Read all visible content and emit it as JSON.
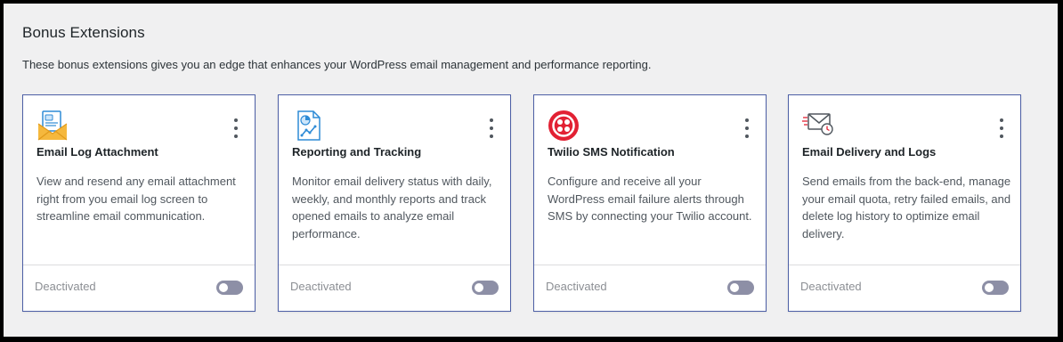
{
  "section": {
    "title": "Bonus Extensions",
    "subtitle": "These bonus extensions gives you an edge that enhances your WordPress email management and performance reporting."
  },
  "cards": [
    {
      "name": "Email Log Attachment",
      "icon": "email-attachment-icon",
      "description": "View and resend any email attachment right from you email log screen to streamline email communication.",
      "status": "Deactivated",
      "enabled": false
    },
    {
      "name": "Reporting and Tracking",
      "icon": "report-chart-icon",
      "description": "Monitor email delivery status with daily, weekly, and monthly reports and track opened emails to analyze email performance.",
      "status": "Deactivated",
      "enabled": false
    },
    {
      "name": "Twilio SMS Notification",
      "icon": "twilio-logo-icon",
      "description": "Configure and receive all your WordPress email failure alerts through SMS by connecting your Twilio account.",
      "status": "Deactivated",
      "enabled": false
    },
    {
      "name": "Email Delivery and Logs",
      "icon": "email-clock-icon",
      "description": "Send emails from the back-end, manage your email quota, retry failed emails, and delete log history to optimize email delivery.",
      "status": "Deactivated",
      "enabled": false
    }
  ],
  "colors": {
    "card_border": "#4d5fa6",
    "toggle_off": "#8d8fa6",
    "twilio_red": "#e22133"
  }
}
